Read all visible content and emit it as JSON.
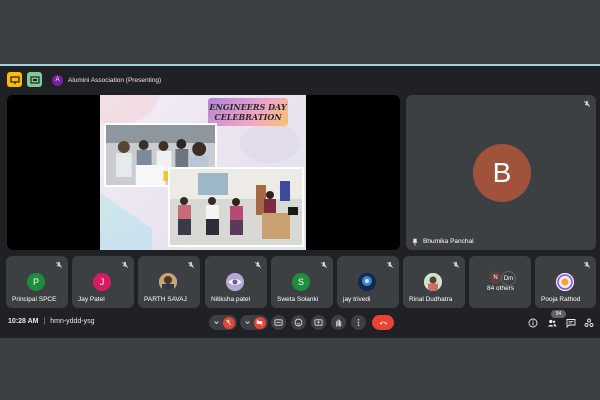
{
  "presentation": {
    "title": "Alumini Association (Presenting)",
    "presenter_initial": "A",
    "slide_title_line1": "ENGINEERS DAY",
    "slide_title_line2": "CELEBRATION"
  },
  "main_tile": {
    "name": "Bhumika Panchal",
    "initial": "B",
    "color": "#a0523a"
  },
  "participants": [
    {
      "name": "Principal SPCE",
      "initial": "P",
      "color": "#1e8e3e"
    },
    {
      "name": "Jay Patel",
      "initial": "J",
      "color": "#d81b60"
    },
    {
      "name": "PARTH SAVAJ",
      "initial": "",
      "color": "#c7a27a"
    },
    {
      "name": "Nitiksha patel",
      "initial": "",
      "color": "#8e7cc3"
    },
    {
      "name": "Sweta Solanki",
      "initial": "S",
      "color": "#1e8e3e"
    },
    {
      "name": "jay trivedi",
      "initial": "",
      "color": "#1a3c6e"
    },
    {
      "name": "Rinal Dudhatra",
      "initial": "",
      "color": "#b7d3b0"
    },
    {
      "name": "Pooja Rathod",
      "initial": "",
      "color": "#e8eaed"
    }
  ],
  "others": {
    "label": "84 others",
    "av1": "N",
    "av2": "Dm"
  },
  "footer": {
    "time": "10:28 AM",
    "separator": "|",
    "meeting_code": "hmn-yddd-ysg",
    "participant_count": "94"
  },
  "colors": {
    "accent_red": "#ea4335",
    "background": "#202124",
    "tile": "#3c4043"
  }
}
